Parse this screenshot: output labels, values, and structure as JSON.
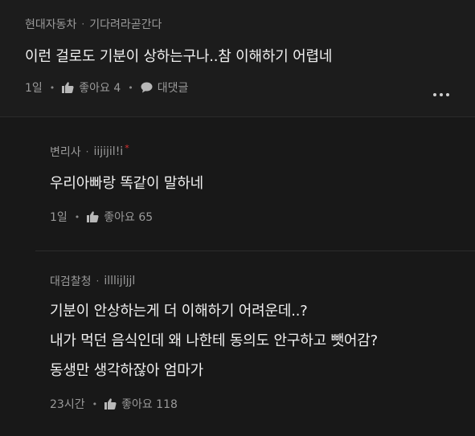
{
  "comments": [
    {
      "author": "현대자동차",
      "separator": "·",
      "handle": "기다려라곧간다",
      "lines": [
        "이런 걸로도 기분이 상하는구나..참 이해하기 어렵네"
      ],
      "time": "1일",
      "like_label": "좋아요 4",
      "reply_label": "대댓글"
    }
  ],
  "replies": [
    {
      "author": "변리사",
      "separator": "·",
      "handle": "iijijil!i",
      "badge": "*",
      "lines": [
        "우리아빠랑 똑같이 말하네"
      ],
      "time": "1일",
      "like_label": "좋아요 65"
    },
    {
      "author": "대검찰청",
      "separator": "·",
      "handle": "illlijljjl",
      "lines": [
        "기분이 안상하는게 더 이해하기 어려운데..?",
        "내가 먹던 음식인데 왜 나한테 동의도 안구하고 뺏어감?",
        "동생만 생각하잖아 엄마가"
      ],
      "time": "23시간",
      "like_label": "좋아요 118"
    }
  ],
  "action_separator": "•",
  "icons": {
    "like": "thumbs-up-icon",
    "reply": "speech-bubble-icon",
    "more": "more-dots-icon"
  },
  "colors": {
    "background": "#181818",
    "text": "#f0f0f0",
    "muted": "#9a9a9a",
    "badge": "#dd3333"
  }
}
